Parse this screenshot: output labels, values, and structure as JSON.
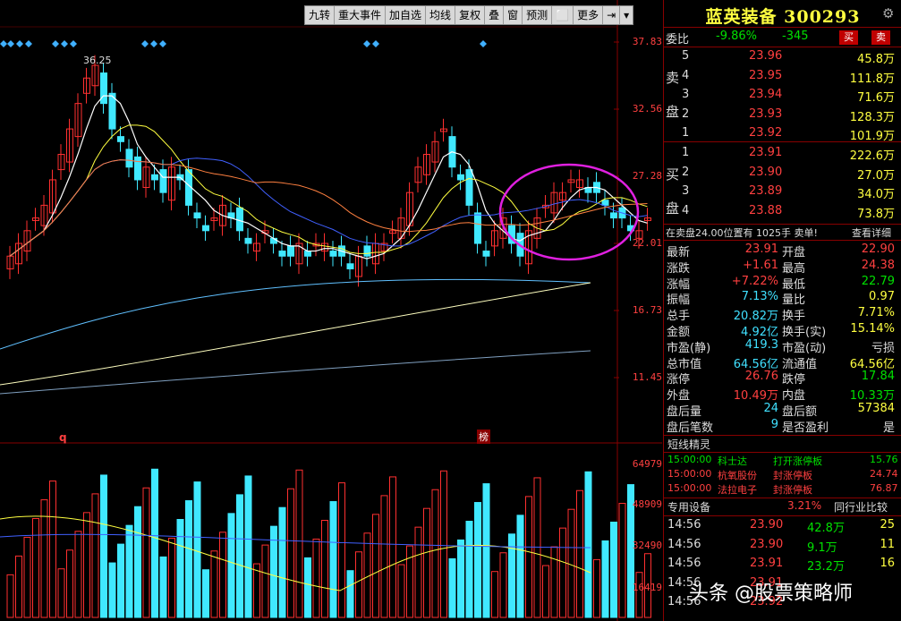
{
  "toolbar": [
    "九转",
    "重大事件",
    "加自选",
    "均线",
    "复权",
    "叠",
    "窗",
    "预测",
    "⬜",
    "更多",
    "⇥",
    "▾"
  ],
  "price_axis": [
    "37.83",
    "32.56",
    "27.28",
    "22.01",
    "16.73",
    "11.45"
  ],
  "volume_axis": [
    "64979",
    "48909",
    "32490",
    "16419"
  ],
  "chart_labels": {
    "peak": "36.25",
    "q_marker": "q",
    "bang_marker": "榜"
  },
  "colors": {
    "up": "#ff3030",
    "down": "#40e8ff",
    "ma5": "#ffffff",
    "ma10": "#ffff40",
    "ma20": "#ff40ff",
    "ma60": "#40ff40",
    "circle": "#e020e0"
  },
  "stock": {
    "title": "蓝英装备 300293"
  },
  "weibi": {
    "label": "委比",
    "pct": "-9.86%",
    "diff": "-345",
    "buy_btn": "买",
    "sell_btn": "卖"
  },
  "sell_side": {
    "label_1": "卖",
    "label_2": "盘",
    "rows": [
      {
        "lvl": "5",
        "price": "23.96",
        "vol": "45.8万"
      },
      {
        "lvl": "4",
        "price": "23.95",
        "vol": "111.8万"
      },
      {
        "lvl": "3",
        "price": "23.94",
        "vol": "71.6万"
      },
      {
        "lvl": "2",
        "price": "23.93",
        "vol": "128.3万"
      },
      {
        "lvl": "1",
        "price": "23.92",
        "vol": "101.9万"
      }
    ]
  },
  "buy_side": {
    "label_1": "买",
    "label_2": "盘",
    "rows": [
      {
        "lvl": "1",
        "price": "23.91",
        "vol": "222.6万"
      },
      {
        "lvl": "2",
        "price": "23.90",
        "vol": "27.0万"
      },
      {
        "lvl": "3",
        "price": "23.89",
        "vol": "34.0万"
      },
      {
        "lvl": "4",
        "price": "23.88",
        "vol": "73.8万"
      }
    ]
  },
  "notice": {
    "text": "在卖盘24.00位置有 1025手 卖单!",
    "link": "查看详细"
  },
  "stats": [
    {
      "l1": "最新",
      "v1": "23.91",
      "l2": "开盘",
      "v2": "22.90"
    },
    {
      "l1": "涨跌",
      "v1": "+1.61",
      "l2": "最高",
      "v2": "24.38"
    },
    {
      "l1": "涨幅",
      "v1": "+7.22%",
      "l2": "最低",
      "v2": "22.79"
    },
    {
      "l1": "振幅",
      "v1": "7.13%",
      "l2": "量比",
      "v2": "0.97"
    },
    {
      "l1": "总手",
      "v1": "20.82万",
      "l2": "换手",
      "v2": "7.71%"
    },
    {
      "l1": "金额",
      "v1": "4.92亿",
      "l2": "换手(实)",
      "v2": "15.14%"
    },
    {
      "l1": "市盈(静)",
      "v1": "419.3",
      "l2": "市盈(动)",
      "v2": "亏损"
    },
    {
      "l1": "总市值",
      "v1": "64.56亿",
      "l2": "流通值",
      "v2": "64.56亿"
    },
    {
      "l1": "涨停",
      "v1": "26.76",
      "l2": "跌停",
      "v2": "17.84"
    },
    {
      "l1": "外盘",
      "v1": "10.49万",
      "l2": "内盘",
      "v2": "10.33万"
    },
    {
      "l1": "盘后量",
      "v1": "24",
      "l2": "盘后额",
      "v2": "57384"
    },
    {
      "l1": "盘后笔数",
      "v1": "9",
      "l2": "是否盈利",
      "v2": "是"
    }
  ],
  "short_line": {
    "title": "短线精灵",
    "rows": [
      {
        "time": "15:00:00",
        "name": "科士达",
        "event": "打开涨停板",
        "val": "15.76"
      },
      {
        "time": "15:00:00",
        "name": "杭氧股份",
        "event": "封涨停板",
        "val": "24.74"
      },
      {
        "time": "15:00:00",
        "name": "法拉电子",
        "event": "封涨停板",
        "val": "76.87"
      }
    ]
  },
  "industry": {
    "name": "专用设备",
    "pct": "3.21%",
    "compare": "同行业比较"
  },
  "ticks": [
    {
      "time": "14:56",
      "price": "23.90",
      "vol": "42.8万",
      "n": "25"
    },
    {
      "time": "14:56",
      "price": "23.90",
      "vol": "9.1万",
      "n": "11"
    },
    {
      "time": "14:56",
      "price": "23.91",
      "vol": "23.2万",
      "n": "16"
    },
    {
      "time": "14:56",
      "price": "23.91",
      "vol": "",
      "n": ""
    },
    {
      "time": "14:56",
      "price": "23.92",
      "vol": "",
      "n": ""
    }
  ],
  "watermark": "头条 @股票策略师"
}
